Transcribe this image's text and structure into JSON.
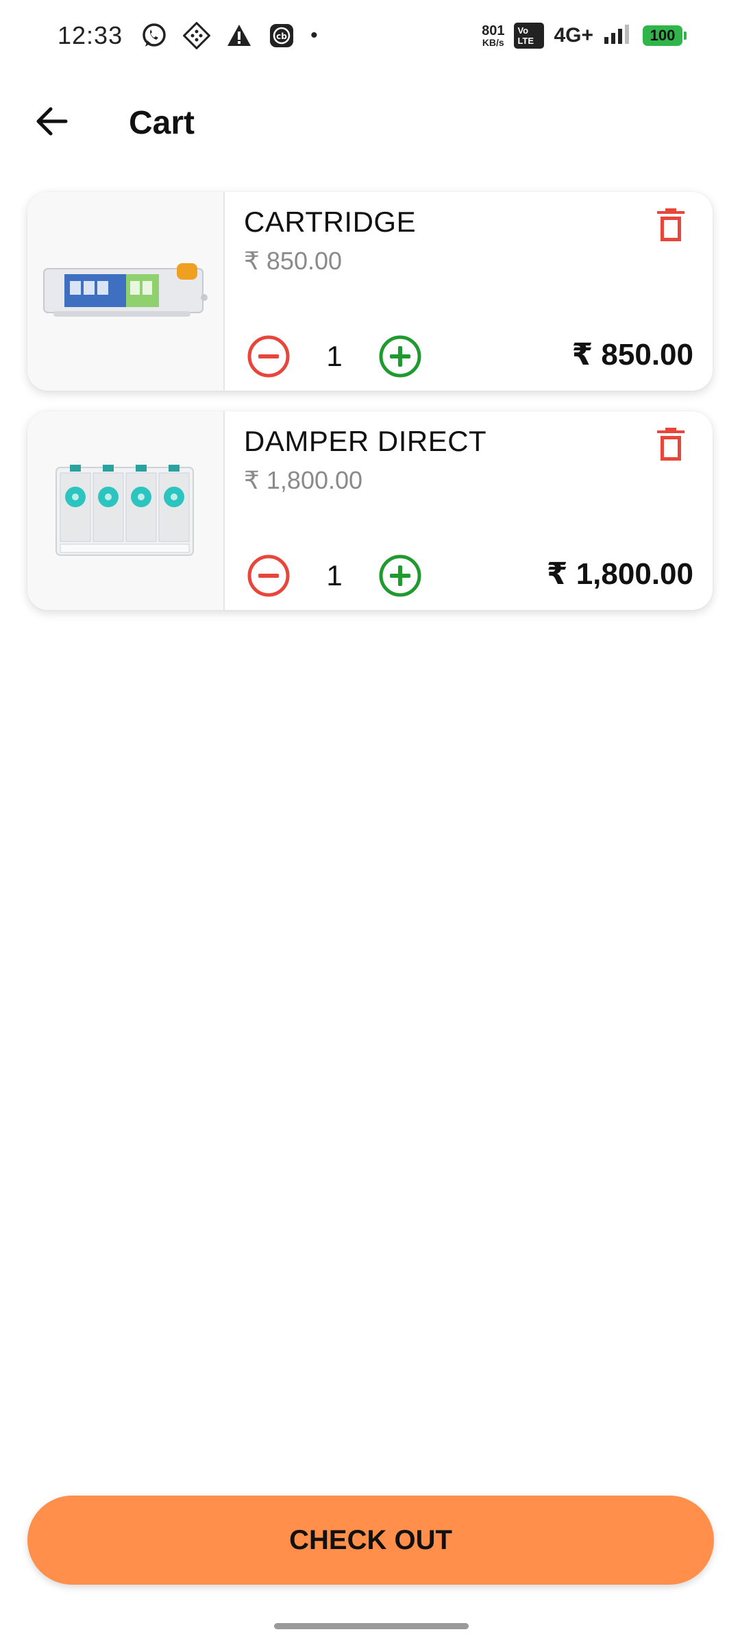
{
  "status_bar": {
    "time": "12:33",
    "speed_value": "801",
    "speed_unit": "KB/s",
    "volte_top": "Vo",
    "volte_bottom": "LTE",
    "network": "4G+",
    "battery": "100",
    "battery_color": "#2fb54a",
    "icons": [
      "whatsapp-icon",
      "game-controller-icon",
      "warning-icon",
      "cb-app-icon"
    ]
  },
  "header": {
    "title": "Cart"
  },
  "cart": {
    "items": [
      {
        "name": "CARTRIDGE",
        "unit_price": "₹ 850.00",
        "quantity": "1",
        "total": "₹ 850.00",
        "image": "cartridge-image"
      },
      {
        "name": "DAMPER DIRECT",
        "unit_price": "₹ 1,800.00",
        "quantity": "1",
        "total": "₹ 1,800.00",
        "image": "damper-image"
      }
    ]
  },
  "checkout": {
    "label": "CHECK OUT"
  },
  "colors": {
    "accent": "#ff8f4a",
    "delete": "#e8463a",
    "decrement": "#e8463a",
    "increment": "#1f9a2f"
  }
}
